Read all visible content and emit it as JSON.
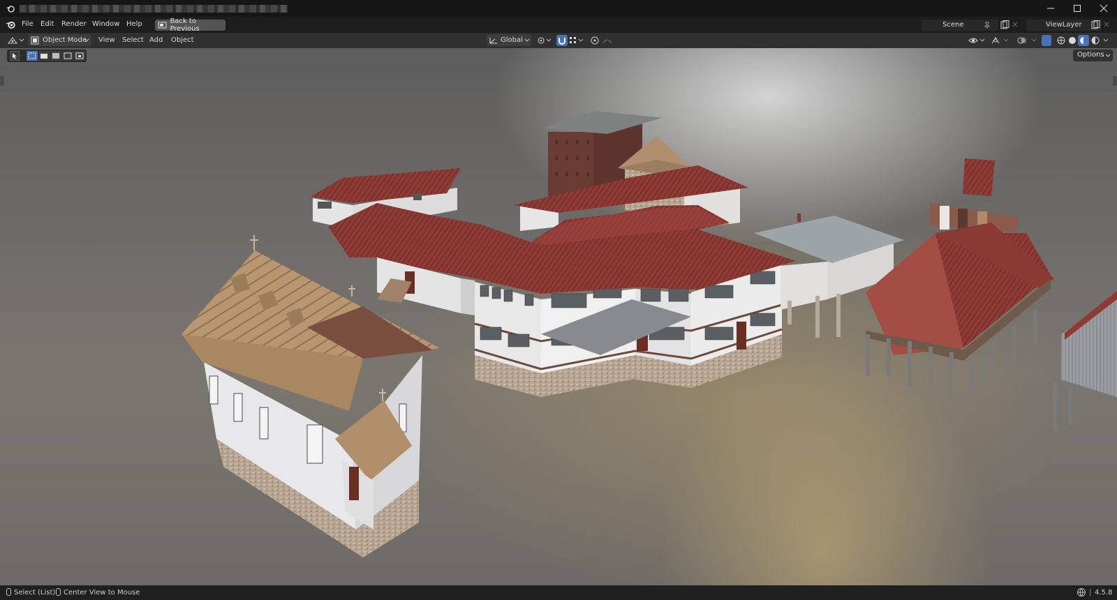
{
  "titlebar": {
    "window_controls": [
      "minimize-icon",
      "maximize-icon",
      "close-icon"
    ]
  },
  "menubar": {
    "items": [
      "File",
      "Edit",
      "Render",
      "Window",
      "Help"
    ],
    "back_button": "Back to Previous",
    "scene": "Scene",
    "view_layer": "ViewLayer"
  },
  "header": {
    "mode": "Object Mode",
    "menus": [
      "View",
      "Select",
      "Add",
      "Object"
    ],
    "orientation": "Global"
  },
  "viewport": {
    "options_label": "Options",
    "accent_color": "#4772b3"
  },
  "statusbar": {
    "select_hint": "Select (List)",
    "center_hint": "Center View to Mouse",
    "version": "4.5.8"
  }
}
